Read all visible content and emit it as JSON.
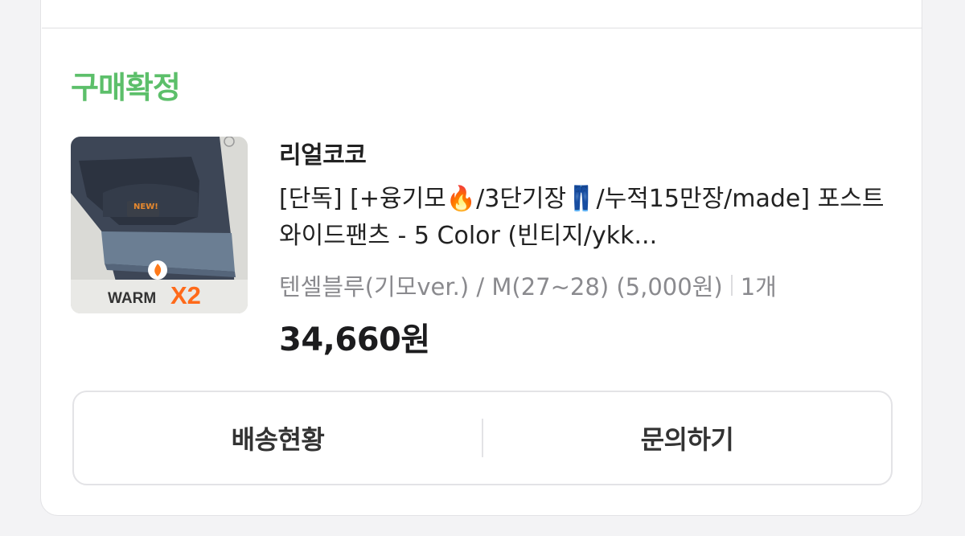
{
  "order": {
    "status": "구매확정",
    "seller": "리얼코코",
    "product_title": "[단독] [+융기모🔥/3단기장👖/누적15만장/made] 포스트 와이드팬츠 - 5 Color (빈티지/ykk...",
    "option": "텐셀블루(기모ver.) / M(27~28)  (5,000원)",
    "quantity": "1개",
    "price": "34,660원",
    "thumbnail": {
      "badge_text": "NEW!",
      "caption_word": "WARM",
      "caption_mult": "X2",
      "icons": [
        "fire-icon",
        "settings-dot-icon"
      ]
    }
  },
  "actions": {
    "shipping_label": "배송현황",
    "inquiry_label": "문의하기"
  },
  "colors": {
    "status_green": "#5cbf6a",
    "accent_orange": "#ff6a1a"
  }
}
